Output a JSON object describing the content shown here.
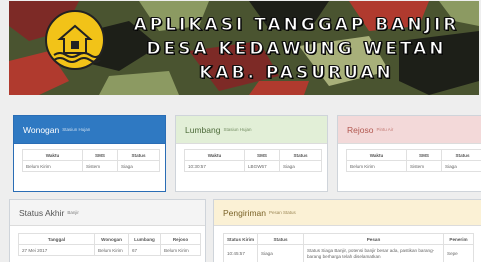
{
  "banner": {
    "line1": "APLIKASI TANGGAP BANJIR",
    "line2": "DESA KEDAWUNG WETAN",
    "line3": "KAB. PASURUAN",
    "logo_icon": "house-flood-icon"
  },
  "colors": {
    "primary": "#2f79c2",
    "success_bg": "#e2efd7",
    "danger_bg": "#f3d9d9",
    "warning_bg": "#fbf1d5",
    "logo_yellow": "#f2c318"
  },
  "stations": [
    {
      "name": "Wonogan",
      "sub": "Stasiun Hujan",
      "headers": [
        "Waktu",
        "SMS",
        "Status"
      ],
      "row": [
        "Belum Kirim",
        "Sistem",
        "Siaga"
      ]
    },
    {
      "name": "Lumbang",
      "sub": "Stasiun Hujan",
      "headers": [
        "Waktu",
        "SMS",
        "Status"
      ],
      "row": [
        "10:30:57",
        "LBGW67",
        "Siaga"
      ]
    },
    {
      "name": "Rejoso",
      "sub": "Pintu Air",
      "headers": [
        "Waktu",
        "SMS",
        "Status"
      ],
      "row": [
        "Belum Kirim",
        "Sistem",
        "Siaga"
      ]
    }
  ],
  "status_akhir": {
    "title": "Status Akhir",
    "sub": "Banjir",
    "headers": [
      "Tanggal",
      "Wonogan",
      "Lumbang",
      "Rejoso"
    ],
    "row": [
      "27 Mei 2017",
      "Belum Kirim",
      "67",
      "Belum Kirim"
    ]
  },
  "pengiriman": {
    "title": "Pengiriman",
    "sub": "Pesan Status",
    "headers": [
      "Status Kirim",
      "Status",
      "Pesan",
      "Penerim"
    ],
    "row": [
      "10:45:57",
      "Siaga",
      "Status Siaga Banjir, potensi banjir besar ada, pastikan barang-barang berharga telah diselamatkan",
      "Sepe"
    ]
  }
}
